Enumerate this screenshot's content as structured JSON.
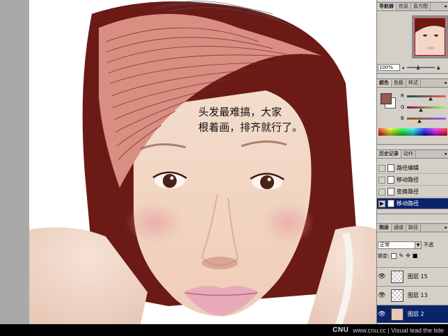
{
  "canvas": {
    "caption_lines": [
      "头发最难搞，大家",
      "根着画，排齐就行了。"
    ],
    "colors": {
      "hair": "#6b1a16",
      "hair_strands": "#d98e82",
      "skin": "#f2d7c6",
      "lips": "#e8aab8"
    }
  },
  "navigator": {
    "tabs": [
      "导航器",
      "信息",
      "直方图"
    ],
    "zoom_value": "100%"
  },
  "color_panel": {
    "tabs": [
      "颜色",
      "色板",
      "样式"
    ],
    "foreground": "#985a50",
    "channels": [
      {
        "label": "R",
        "fraction": 0.6
      },
      {
        "label": "G",
        "fraction": 0.35
      },
      {
        "label": "B",
        "fraction": 0.31
      }
    ]
  },
  "history": {
    "tabs": [
      "历史记录",
      "动作"
    ],
    "items": [
      {
        "label": "路径编辑",
        "selected": false
      },
      {
        "label": "移动路径",
        "selected": false
      },
      {
        "label": "变换路径",
        "selected": false
      },
      {
        "label": "移动路径",
        "selected": true
      }
    ]
  },
  "layers": {
    "tabs": [
      "图层",
      "通道",
      "路径"
    ],
    "blend_mode": "正常",
    "opacity_label": "不透",
    "lock_label": "锁定:",
    "items": [
      {
        "label": "图层 15",
        "selected": false,
        "thumb": "transparent"
      },
      {
        "label": "图层 13",
        "selected": false,
        "thumb": "transparent"
      },
      {
        "label": "图层 2",
        "selected": true,
        "thumb": "image"
      }
    ]
  },
  "footer": {
    "logo": "CNU",
    "tagline": "www.cnu.cc | Visual lead the tide"
  }
}
